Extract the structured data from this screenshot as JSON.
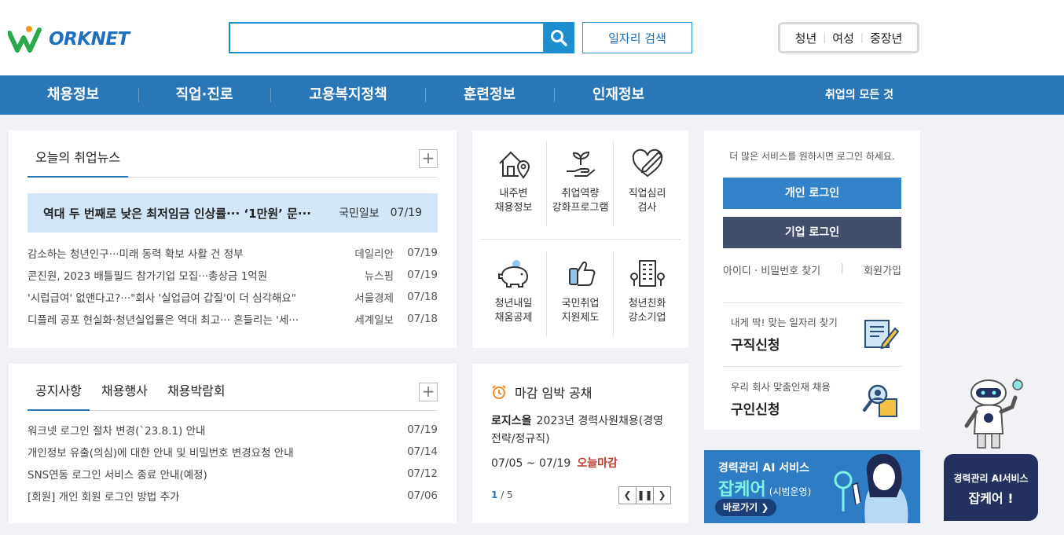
{
  "header": {
    "logo": "ORKNET",
    "search_placeholder": "",
    "job_search_label": "일자리 검색",
    "targets": [
      "청년",
      "여성",
      "중장년"
    ]
  },
  "nav": {
    "items": [
      "채용정보",
      "직업·진로",
      "고용복지정책",
      "훈련정보",
      "인재정보"
    ],
    "all_label": "취업의 모든 것"
  },
  "news": {
    "tab_label": "오늘의 취업뉴스",
    "headline": {
      "title": "역대 두 번째로 낮은 최저임금 인상률··· ‘1만원’ 문···",
      "source": "국민일보",
      "date": "07/19"
    },
    "items": [
      {
        "title": "감소하는 청년인구···미래 동력 확보 사활 건 정부",
        "source": "데일리안",
        "date": "07/19"
      },
      {
        "title": "콘진원, 2023 배틀필드 참가기업 모집···총상금 1억원",
        "source": "뉴스핌",
        "date": "07/19"
      },
      {
        "title": "'시럽급여' 없앤다고?···\"회사 '실업급여 갑질'이 더 심각해요\"",
        "source": "서울경제",
        "date": "07/18"
      },
      {
        "title": "디플레 공포 현실화·청년실업률은 역대 최고··· 흔들리는 '세···",
        "source": "세계일보",
        "date": "07/18"
      }
    ]
  },
  "notice": {
    "tabs": [
      "공지사항",
      "채용행사",
      "채용박람회"
    ],
    "items": [
      {
        "title": "워크넷 로그인 절차 변경(`23.8.1) 안내",
        "date": "07/19"
      },
      {
        "title": "개인정보 유출(의심)에 대한 안내 및 비밀번호 변경요청 안내",
        "date": "07/14"
      },
      {
        "title": "SNS연동 로그인 서비스 종료 안내(예정)",
        "date": "07/12"
      },
      {
        "title": "[회원] 개인 회원 로그인 방법 추가",
        "date": "07/06"
      }
    ]
  },
  "services": [
    {
      "label": "내주변\n채용정보",
      "icon": "house-pin-icon"
    },
    {
      "label": "취업역량\n강화프로그램",
      "icon": "hand-sprout-icon"
    },
    {
      "label": "직업심리\n검사",
      "icon": "heart-pen-icon"
    },
    {
      "label": "청년내일\n채움공제",
      "icon": "piggy-bank-icon"
    },
    {
      "label": "국민취업\n지원제도",
      "icon": "thumbs-up-icon"
    },
    {
      "label": "청년친화\n강소기업",
      "icon": "building-icon"
    }
  ],
  "deadline": {
    "title": "마감 임박 공채",
    "company": "로지스올",
    "job": "2023년 경력사원채용(경영전략/정규직)",
    "period": "07/05 ~ 07/19",
    "urgent": "오늘마감",
    "page_current": "1",
    "page_total": "/ 5"
  },
  "login": {
    "message": "더 많은 서비스를 원하시면 로그인 하세요.",
    "personal": "개인 로그인",
    "company": "기업 로그인",
    "find": "아이디 · 비밀번호 찾기",
    "join": "회원가입",
    "promo1_sub": "내게 딱! 맞는 일자리 찾기",
    "promo1_main": "구직신청",
    "promo2_sub": "우리 회사 맞춤인재 채용",
    "promo2_main": "구인신청"
  },
  "banner": {
    "line1": "경력관리 AI 서비스",
    "brand": "잡케어",
    "trial": "(시범운영)",
    "go": "바로가기 ❯"
  },
  "robot_card": {
    "line1": "경력관리 AI서비스",
    "line2": "잡케어 !"
  },
  "colors": {
    "primary": "#2a77b8",
    "search": "#1d8fd1",
    "company_btn": "#434f6a",
    "urgent": "#c0392b"
  }
}
